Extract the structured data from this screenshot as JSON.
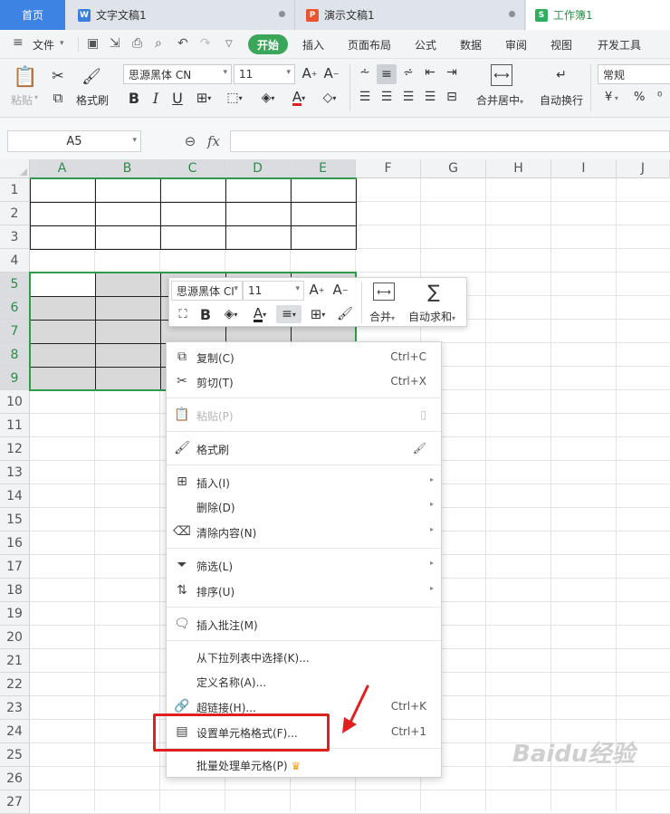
{
  "tabs": [
    {
      "label": "首页"
    },
    {
      "label": "文字文稿1",
      "icon": "W",
      "color": "#3a7fe0"
    },
    {
      "label": "演示文稿1",
      "icon": "P",
      "color": "#e8552f"
    },
    {
      "label": "工作簿1",
      "icon": "S",
      "color": "#2fae62"
    }
  ],
  "menu": {
    "file": "文件",
    "start": "开始",
    "items": [
      "插入",
      "页面布局",
      "公式",
      "数据",
      "审阅",
      "视图",
      "开发工具"
    ]
  },
  "ribbon": {
    "paste": "粘贴",
    "format_painter": "格式刷",
    "font_name": "思源黑体 CN",
    "font_size": "11",
    "merge": "合并居中",
    "wrap": "自动换行",
    "number_format": "常规",
    "currency": "¥",
    "percent": "%"
  },
  "formula": {
    "name_box": "A5",
    "fx": "fx"
  },
  "columns": [
    "A",
    "B",
    "C",
    "D",
    "E",
    "F",
    "G",
    "H",
    "I",
    "J"
  ],
  "rows": [
    "1",
    "2",
    "3",
    "4",
    "5",
    "6",
    "7",
    "8",
    "9",
    "10",
    "11",
    "12",
    "13",
    "14",
    "15",
    "16",
    "17",
    "18",
    "19",
    "20",
    "21",
    "22",
    "23",
    "24",
    "25",
    "26",
    "27"
  ],
  "mini_toolbar": {
    "font_name": "思源黑体 CI",
    "font_size": "11",
    "merge": "合并",
    "autosum": "自动求和"
  },
  "context_menu": [
    {
      "label": "复制(C)",
      "shortcut": "Ctrl+C",
      "icon": "copy-icon"
    },
    {
      "label": "剪切(T)",
      "shortcut": "Ctrl+X",
      "icon": "scissors-icon"
    },
    {
      "label": "粘贴(P)",
      "shortcut": "",
      "icon": "paste-icon",
      "disabled": true
    },
    {
      "label": "格式刷",
      "shortcut": "",
      "icon": "format-painter-icon"
    },
    {
      "label": "插入(I)",
      "icon": "insert-icon",
      "submenu": true
    },
    {
      "label": "删除(D)",
      "submenu": true
    },
    {
      "label": "清除内容(N)",
      "icon": "eraser-icon",
      "submenu": true
    },
    {
      "label": "筛选(L)",
      "icon": "filter-icon",
      "submenu": true
    },
    {
      "label": "排序(U)",
      "icon": "sort-icon",
      "submenu": true
    },
    {
      "label": "插入批注(M)",
      "icon": "comment-icon"
    },
    {
      "label": "从下拉列表中选择(K)..."
    },
    {
      "label": "定义名称(A)..."
    },
    {
      "label": "超链接(H)...",
      "shortcut": "Ctrl+K",
      "icon": "link-icon"
    },
    {
      "label": "设置单元格格式(F)...",
      "shortcut": "Ctrl+1",
      "icon": "format-cells-icon"
    },
    {
      "label": "批量处理单元格(P)",
      "icon": "crown-icon"
    }
  ],
  "colors": {
    "accent": "#3aa65a",
    "selection": "#2d9a4c",
    "highlight": "#e02020",
    "watermark": "#d0d0d0"
  },
  "watermark": "Baidu经验"
}
